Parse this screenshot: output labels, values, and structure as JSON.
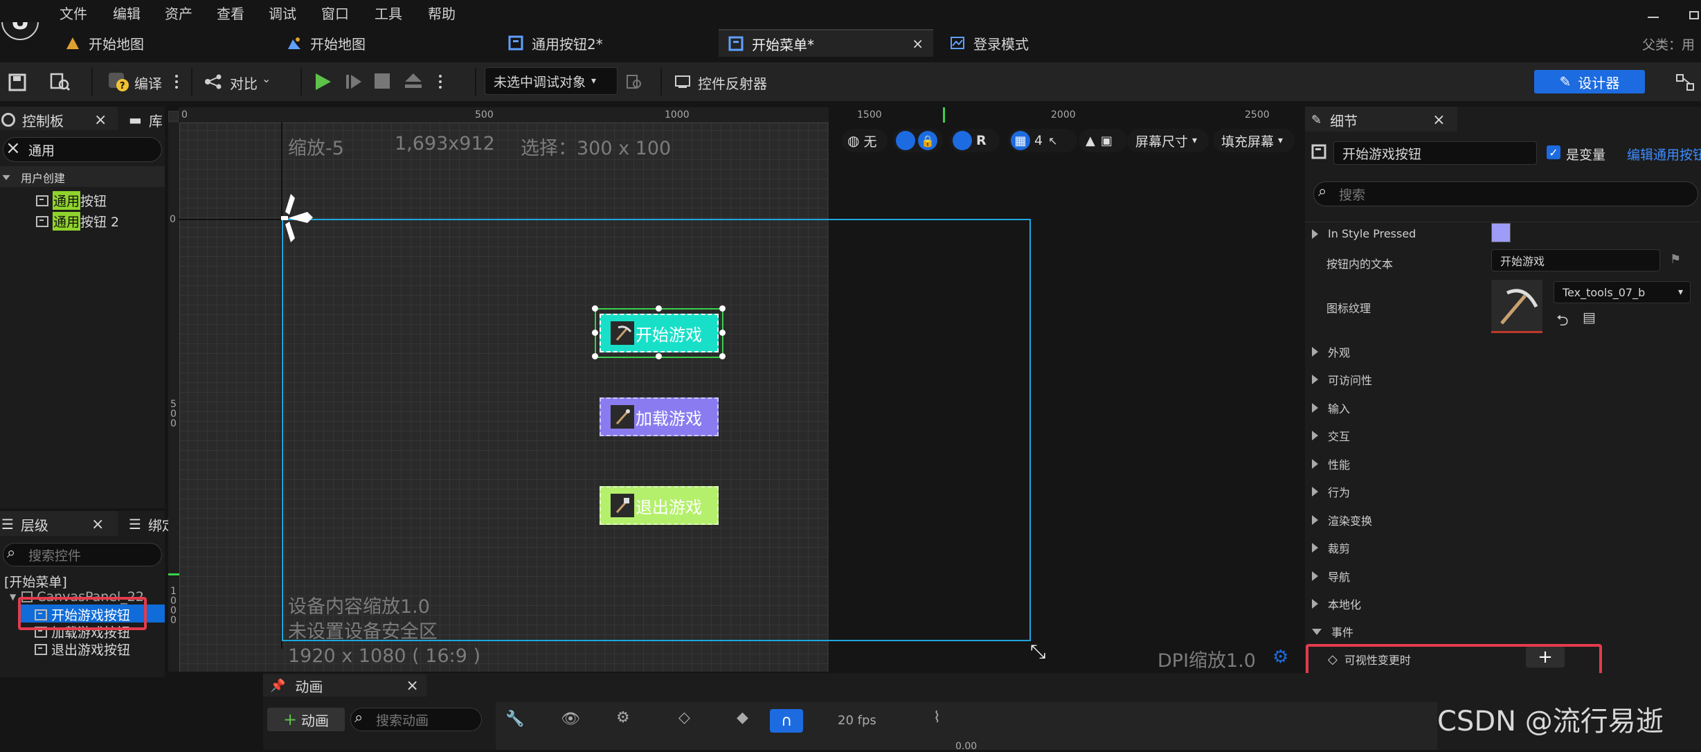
{
  "menu": [
    "文件",
    "编辑",
    "资产",
    "查看",
    "调试",
    "窗口",
    "工具",
    "帮助"
  ],
  "tabs": [
    {
      "label": "开始地图",
      "active": false
    },
    {
      "label": "开始地图",
      "active": false
    },
    {
      "label": "通用按钮2*",
      "active": false
    },
    {
      "label": "开始菜单*",
      "active": true
    },
    {
      "label": "登录模式",
      "active": false
    }
  ],
  "parent_label": "父类：",
  "parent_value": "用",
  "toolbar": {
    "compile": "编译",
    "diff": "对比",
    "debug_object": "未选中调试对象",
    "widget_reflector": "控件反射器",
    "designer": "设计器"
  },
  "palette": {
    "tab_palette": "控制板",
    "tab_library": "库",
    "search_value": "通用",
    "category": "用户创建",
    "items": [
      {
        "highlight": "通用",
        "rest": "按钮"
      },
      {
        "highlight": "通用",
        "rest": "按钮 2"
      }
    ]
  },
  "hierarchy": {
    "tab_hierarchy": "层级",
    "tab_bind": "绑定控件",
    "search_placeholder": "搜索控件",
    "root": "[开始菜单]",
    "canvas": "CanvasPanel_22",
    "items": [
      "开始游戏按钮",
      "加载游戏按钮",
      "退出游戏按钮"
    ]
  },
  "designer": {
    "zoom": "缩放-5",
    "res": "1,693x912",
    "selection": "选择：300 x 100",
    "none": "无",
    "r": "R",
    "grid_num": "4",
    "screen_size": "屏幕尺寸",
    "fill_screen": "填充屏幕",
    "ruler_top": [
      "0",
      "500",
      "1000",
      "1500",
      "2000",
      "2500"
    ],
    "ruler_left": [
      "0",
      "5\n0\n0",
      "1\n0\n0\n0"
    ],
    "device_scale": "设备内容缩放1.0",
    "safe_zone": "未设置设备安全区",
    "resolution": "1920 x 1080 ( 16:9 )",
    "dpi": "DPI缩放1.0",
    "buttons": [
      {
        "label": "开始游戏",
        "color": "#18e0c8"
      },
      {
        "label": "加载游戏",
        "color": "#8a7cf0"
      },
      {
        "label": "退出游戏",
        "color": "#b4f06c"
      }
    ]
  },
  "details": {
    "tab": "细节",
    "name": "开始游戏按钮",
    "is_variable": "是变量",
    "edit_link": "编辑通用按钮",
    "search_placeholder": "搜索",
    "props": {
      "in_style_pressed": "In Style Pressed",
      "in_style_color": "#9d9cf6",
      "text_label": "按钮内的文本",
      "text_value": "开始游戏",
      "icon_label": "图标纹理",
      "icon_value": "Tex_tools_07_b"
    },
    "categories": [
      "外观",
      "可访问性",
      "输入",
      "交互",
      "性能",
      "行为",
      "渲染变换",
      "裁剪",
      "导航",
      "本地化",
      "事件"
    ],
    "event": "可视性变更时"
  },
  "animation": {
    "tab": "动画",
    "add": "动画",
    "search_placeholder": "搜索动画",
    "fps": "20 fps",
    "value": "0.00"
  },
  "watermark": "CSDN @流行易逝"
}
